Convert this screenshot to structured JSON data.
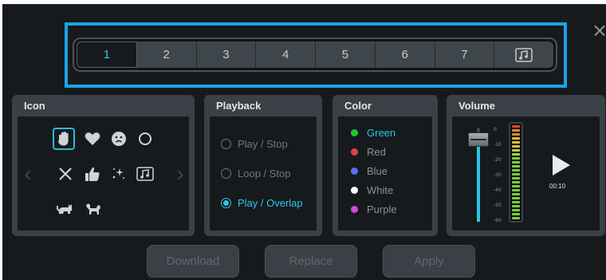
{
  "close_label": "×",
  "tabs": [
    {
      "label": "1",
      "active": true
    },
    {
      "label": "2"
    },
    {
      "label": "3"
    },
    {
      "label": "4"
    },
    {
      "label": "5"
    },
    {
      "label": "6"
    },
    {
      "label": "7"
    },
    {
      "label": "music-note-icon"
    }
  ],
  "icon_panel": {
    "title": "Icon",
    "icons": [
      {
        "name": "hand-icon",
        "glyph": "✋",
        "selected": true
      },
      {
        "name": "heart-icon",
        "glyph": "♥"
      },
      {
        "name": "smiley-icon",
        "glyph": "☹"
      },
      {
        "name": "circle-icon",
        "glyph": "○"
      },
      {
        "name": "x-icon",
        "glyph": "✕"
      },
      {
        "name": "thumbs-up-icon",
        "glyph": "👍"
      },
      {
        "name": "sparkle-icon",
        "glyph": "✨"
      },
      {
        "name": "music-note-icon",
        "glyph": "♫"
      },
      {
        "name": "cat-icon",
        "glyph": "🐈"
      },
      {
        "name": "dog-icon",
        "glyph": "🐕"
      }
    ],
    "prev_arrow": "‹",
    "next_arrow": "›"
  },
  "playback_panel": {
    "title": "Playback",
    "options": [
      {
        "label": "Play / Stop",
        "checked": false
      },
      {
        "label": "Loop / Stop",
        "checked": false
      },
      {
        "label": "Play / Overlap",
        "checked": true
      }
    ]
  },
  "color_panel": {
    "title": "Color",
    "options": [
      {
        "label": "Green",
        "color": "#22c43a",
        "selected": true
      },
      {
        "label": "Red",
        "color": "#e0434a"
      },
      {
        "label": "Blue",
        "color": "#5b6cf2"
      },
      {
        "label": "White",
        "color": "#ffffff"
      },
      {
        "label": "Purple",
        "color": "#d248d8"
      }
    ]
  },
  "volume_panel": {
    "title": "Volume",
    "db_labels": [
      "0",
      "-10",
      "-20",
      "-30",
      "-40",
      "-50",
      "-60"
    ],
    "volume_level": 0.87,
    "time": "00:10"
  },
  "buttons": {
    "download": "Download",
    "replace": "Replace",
    "apply": "Apply"
  },
  "colors": {
    "accent": "#2ec5e8",
    "highlight_border": "#1aa3e6",
    "background": "#171a1c",
    "panel": "#3a4045"
  }
}
